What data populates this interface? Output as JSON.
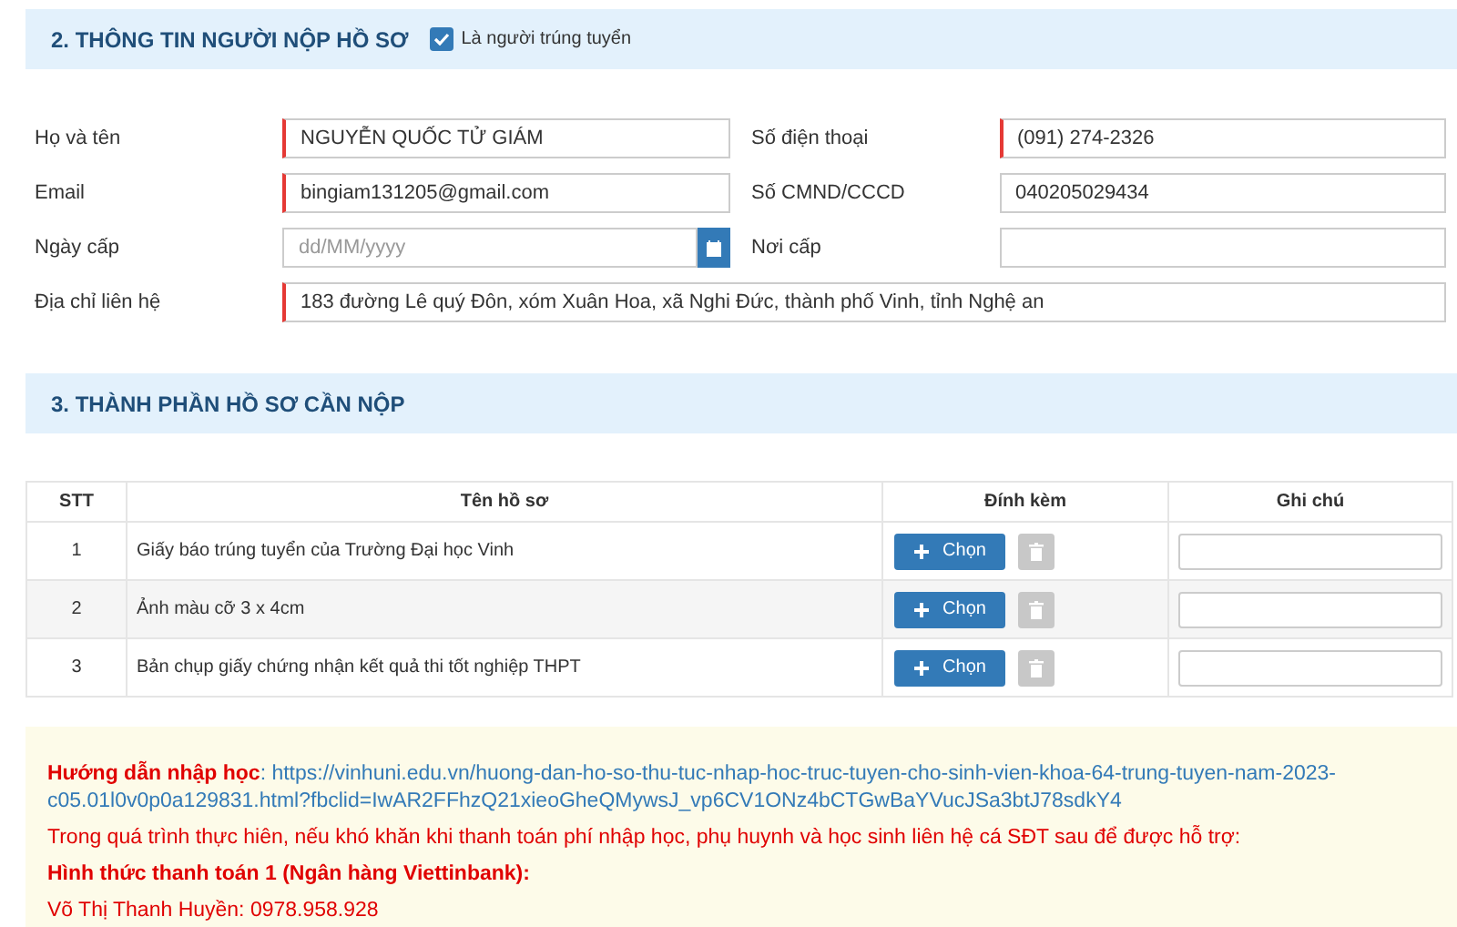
{
  "section_2": {
    "title": "2. THÔNG TIN NGƯỜI NỘP HỒ SƠ",
    "checkbox": {
      "label": "Là người trúng tuyển",
      "checked": true
    },
    "fields": [
      {
        "label": "Họ và tên",
        "value": "NGUYỄN QUỐC TỬ GIÁM",
        "required": true
      },
      {
        "label": "Số điện thoại",
        "value": "(091) 274-2326",
        "required": true
      },
      {
        "label": "Email",
        "value": "bingiam131205@gmail.com",
        "required": true
      },
      {
        "label": "Số CMND/CCCD",
        "value": "040205029434",
        "required": false
      },
      {
        "label": "Ngày cấp",
        "placeholder": "dd/MM/yyyy",
        "required": false,
        "kind": "date"
      },
      {
        "label": "Nơi cấp",
        "required": false
      },
      {
        "label": "Địa chỉ liên hệ",
        "value": "183 đường Lê quý Đôn, xóm Xuân Hoa, xã Nghi Đức, thành phố Vinh, tỉnh Nghệ an",
        "required": true,
        "kind": "wide"
      }
    ]
  },
  "section_3": {
    "title": "3. THÀNH PHẦN HỒ SƠ CẦN NỘP",
    "table": {
      "columns": [
        "STT",
        "Tên hồ sơ",
        "Đính kèm",
        "Ghi chú"
      ],
      "rows": [
        {
          "stt": "1",
          "name": "Giấy báo trúng tuyển của Trường Đại học Vinh",
          "button": "Chọn",
          "delete_disabled": true
        },
        {
          "stt": "2",
          "name": "Ảnh màu cỡ 3 x 4cm",
          "button": "Chọn",
          "delete_disabled": true
        },
        {
          "stt": "3",
          "name": "Bản chụp giấy chứng nhận kết quả thi tốt nghiệp THPT",
          "button": "Chọn",
          "delete_disabled": true
        }
      ]
    }
  },
  "notice": {
    "guide_label": "Hướng dẫn nhập học",
    "guide_colon": ":",
    "guide_link": "https://vinhuni.edu.vn/huong-dan-ho-so-thu-tuc-nhap-hoc-truc-tuyen-cho-sinh-vien-khoa-64-trung-tuyen-nam-2023-c05.01l0v0p0a129831.html?fbclid=IwAR2FFhzQ21xieoGheQMywsJ_vp6CV1ONz4bCTGwBaYVucJSa3btJ78sdkY4",
    "support_text": "Trong quá trình thực hiên, nếu khó khăn khi thanh toán phí nhập học, phụ huynh và học sinh liên hệ cá SĐT sau để được hỗ trợ:",
    "payment_title": "Hình thức thanh toán 1 (Ngân hàng Viettinbank):",
    "contact": "Võ Thị Thanh Huyền: 0978.958.928"
  }
}
